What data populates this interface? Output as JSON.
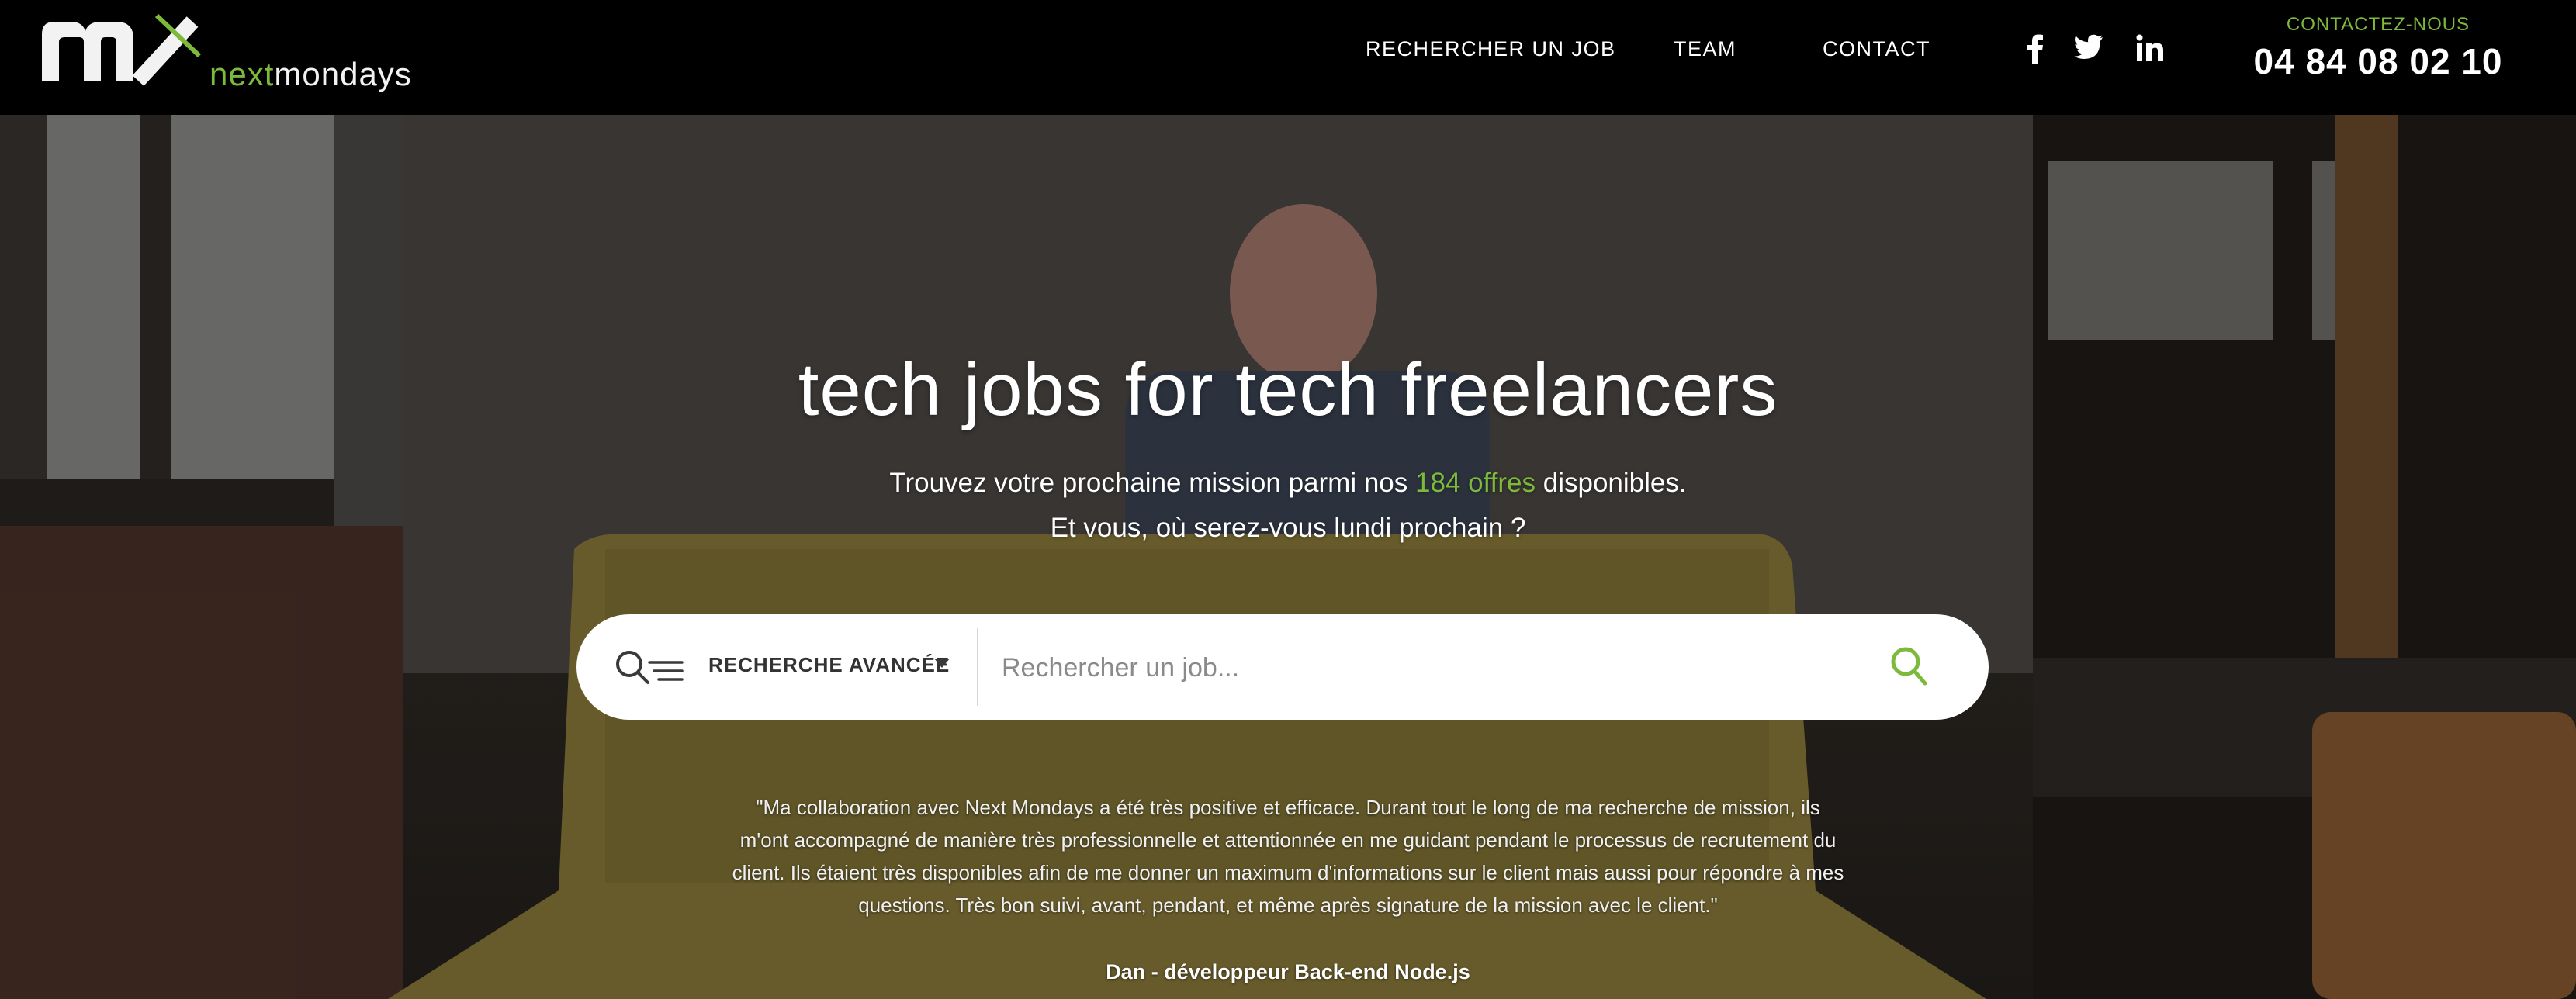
{
  "brand": {
    "logo_mark": "mx",
    "wordmark_next": "next",
    "wordmark_mondays": "mondays",
    "accent_color": "#7dba3c"
  },
  "nav": {
    "items": [
      {
        "label": "RECHERCHER UN JOB"
      },
      {
        "label": "TEAM"
      },
      {
        "label": "CONTACT"
      }
    ]
  },
  "social": [
    {
      "icon": "facebook-icon"
    },
    {
      "icon": "twitter-icon"
    },
    {
      "icon": "linkedin-icon"
    }
  ],
  "contact": {
    "label": "CONTACTEZ-NOUS",
    "phone": "04 84 08 02 10"
  },
  "hero": {
    "headline": "tech jobs for tech freelancers",
    "sub_line1_prefix": "Trouvez votre prochaine mission parmi nos ",
    "offers_link": "184 offres",
    "sub_line1_suffix": " disponibles.",
    "sub_line2": "Et vous, où serez-vous lundi prochain ?"
  },
  "search": {
    "advanced_label": "RECHERCHE AVANCÉE",
    "placeholder": "Rechercher un job...",
    "value": ""
  },
  "testimonial": {
    "quote": "\"Ma collaboration avec Next Mondays a été très positive et efficace. Durant tout le long de ma recherche de mission, ils m'ont accompagné de manière très professionnelle et attentionnée en me guidant pendant le processus de recrutement du client. Ils étaient très disponibles afin de me donner un maximum d'informations sur le client mais aussi pour répondre à mes questions. Très bon suivi, avant, pendant, et même après signature de la mission avec le client.\"",
    "author": "Dan - développeur Back-end Node.js"
  }
}
